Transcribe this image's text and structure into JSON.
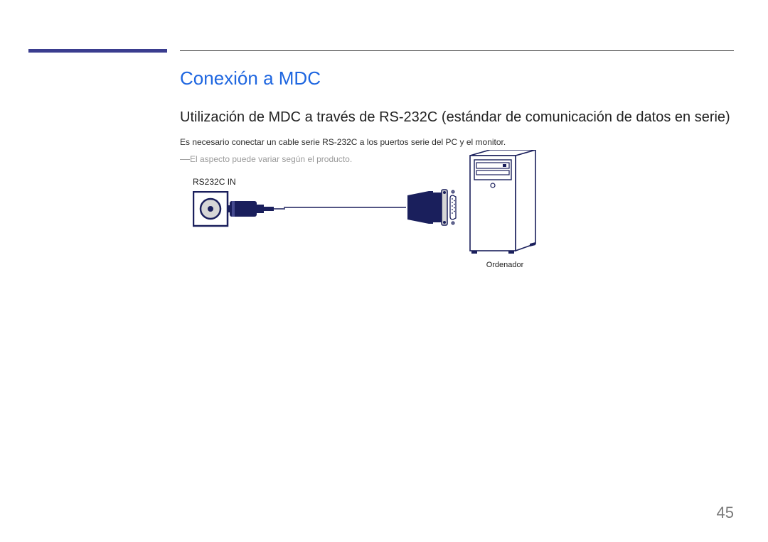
{
  "heading": "Conexión a MDC",
  "subheading": "Utilización de MDC a través de RS-232C (estándar de comunicación de datos en serie)",
  "body_text": "Es necesario conectar un cable serie RS-232C a los puertos serie del PC y el monitor.",
  "note": "El aspecto puede variar según el producto.",
  "port_label": "RS232C IN",
  "computer_caption": "Ordenador",
  "page_number": "45"
}
